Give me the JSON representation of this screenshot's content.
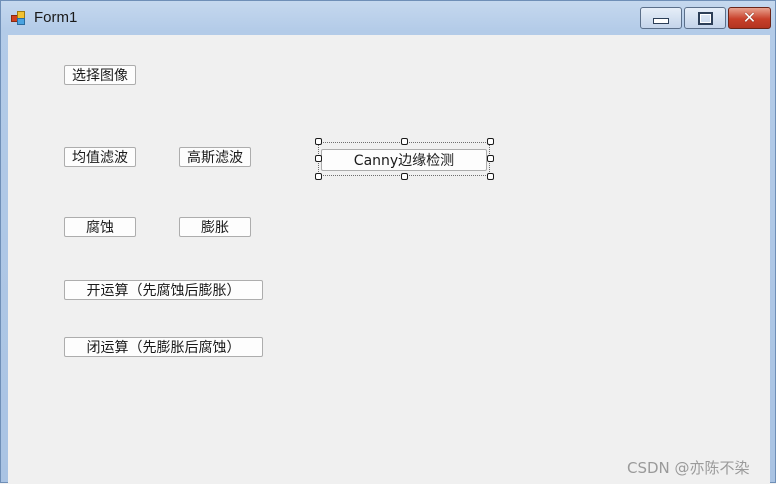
{
  "window": {
    "title": "Form1",
    "controls": {
      "minimize_icon": "minimize-icon",
      "maximize_icon": "maximize-icon",
      "close_icon": "close-icon"
    }
  },
  "buttons": {
    "select_image": "选择图像",
    "mean_filter": "均值滤波",
    "gaussian_filter": "高斯滤波",
    "canny": "Canny边缘检测",
    "erode": "腐蚀",
    "dilate": "膨胀",
    "opening": "开运算（先腐蚀后膨胀）",
    "closing": "闭运算（先膨胀后腐蚀）"
  },
  "watermark": "CSDN @亦陈不染",
  "colors": {
    "titlebar": "#b3cbe8",
    "client_background": "#f0f0f0",
    "close_button": "#c8402a"
  }
}
